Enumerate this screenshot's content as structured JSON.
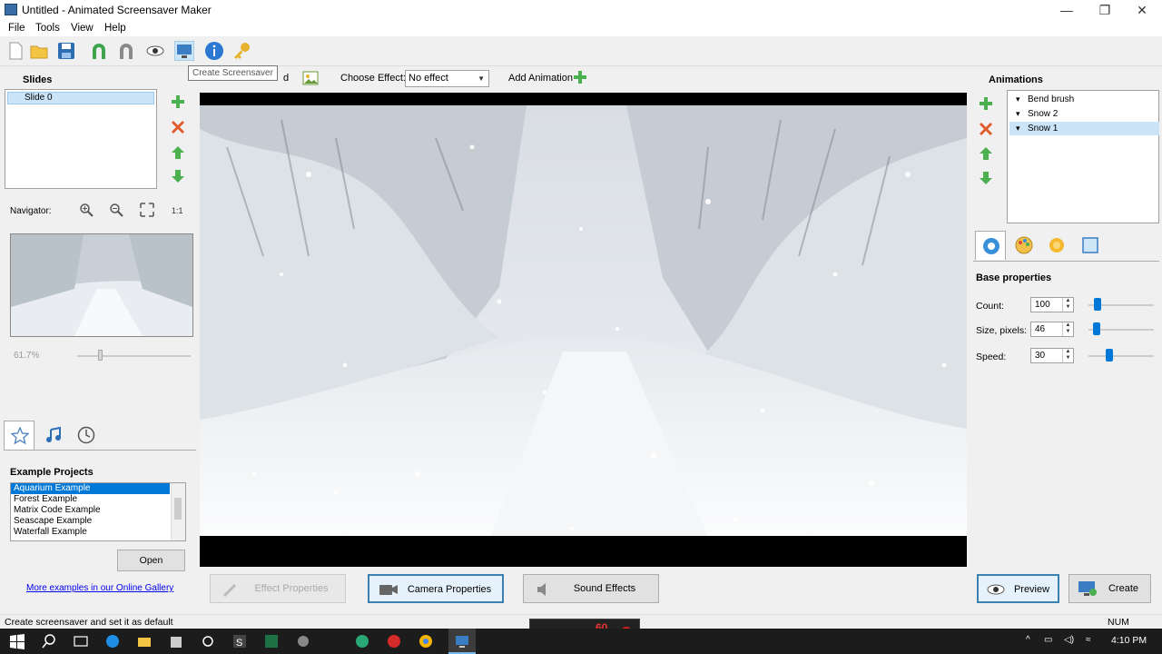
{
  "window": {
    "title": "Untitled - Animated Screensaver Maker",
    "minimize_glyph": "—",
    "restore_glyph": "❐",
    "close_glyph": "✕"
  },
  "menu": [
    "File",
    "Tools",
    "View",
    "Help"
  ],
  "toolbar": {
    "icons": [
      "new-file-icon",
      "open-folder-icon",
      "save-icon",
      "magnet-icon",
      "magnet-gray-icon",
      "eye-icon",
      "monitor-icon",
      "info-icon",
      "key-icon"
    ],
    "tooltip": "Create Screensaver"
  },
  "slides": {
    "header": "Slides",
    "items": [
      "Slide 0"
    ],
    "navigator_label": "Navigator:",
    "zoom": "61.7%"
  },
  "effect_bar": {
    "add_slide_partial": "d",
    "choose_effect_label": "Choose Effect:",
    "effect_value": "No effect",
    "add_animation_label": "Add Animation"
  },
  "examples": {
    "header": "Example Projects",
    "items": [
      "Aquarium Example",
      "Forest Example",
      "Matrix Code Example",
      "Seascape Example",
      "Waterfall Example"
    ],
    "selected": 0,
    "open_label": "Open",
    "gallery_link": "More examples in our Online Gallery"
  },
  "bottom_buttons": {
    "effect_properties": "Effect Properties",
    "camera_properties": "Camera Properties",
    "sound_effects": "Sound Effects",
    "preview": "Preview",
    "create": "Create"
  },
  "animations": {
    "header": "Animations",
    "items": [
      "Bend brush",
      "Snow 2",
      "Snow 1"
    ],
    "selected": 2
  },
  "properties": {
    "header": "Base properties",
    "rows": [
      {
        "label": "Count:",
        "value": "100",
        "level": 0.1
      },
      {
        "label": "Size, pixels:",
        "value": "46",
        "level": 0.08
      },
      {
        "label": "Speed:",
        "value": "30",
        "level": 0.3
      }
    ]
  },
  "status": {
    "text": "Create screensaver and set it as default",
    "indicator": "NUM"
  },
  "taskbar": {
    "time": "4:10 PM",
    "recorder_text": "60"
  },
  "colors": {
    "accent": "#0078d7",
    "selection": "#cce4f7",
    "green_arrow": "#4caf50",
    "red_delete": "#e05a2b"
  }
}
